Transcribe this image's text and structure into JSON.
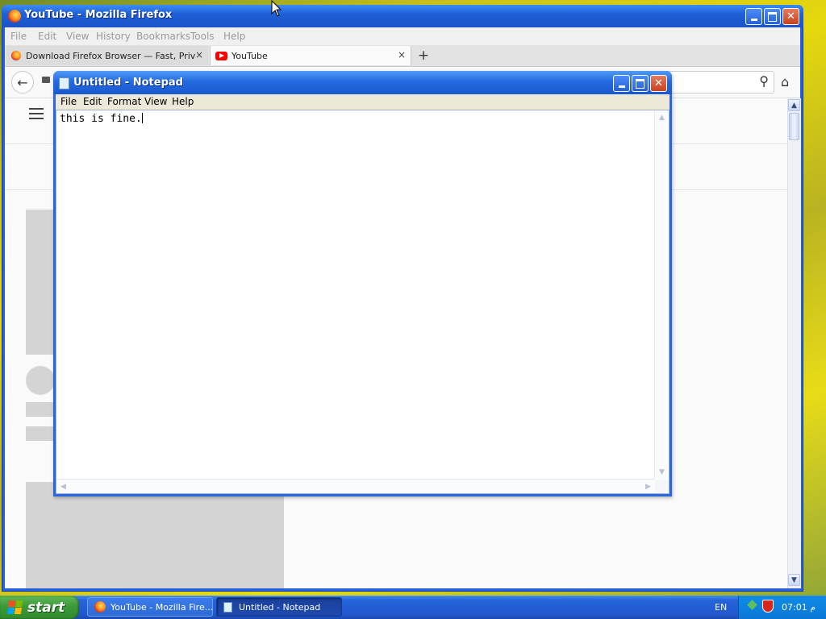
{
  "firefox": {
    "title": "YouTube - Mozilla Firefox",
    "menu": {
      "file": "File",
      "edit": "Edit",
      "view": "View",
      "history": "History",
      "bookmarks": "Bookmarks",
      "tools": "Tools",
      "help": "Help"
    },
    "tabs": [
      {
        "label": "Download Firefox Browser — Fast, Privat...",
        "active": false
      },
      {
        "label": "YouTube",
        "active": true
      }
    ],
    "new_tab": "+",
    "tab_close": "×"
  },
  "notepad": {
    "title": "Untitled - Notepad",
    "menu": {
      "file": "File",
      "edit": "Edit",
      "format": "Format",
      "view": "View",
      "help": "Help"
    },
    "text": "this is fine."
  },
  "taskbar": {
    "start_label": "start",
    "buttons": [
      {
        "label": "YouTube - Mozilla Fire...",
        "active": false
      },
      {
        "label": "Untitled - Notepad",
        "active": true
      }
    ],
    "language": "EN",
    "clock": "07:01 م"
  },
  "icons": {
    "back": "back-arrow-icon",
    "lock": "lock-icon",
    "search": "search-icon",
    "home": "home-icon",
    "hamburger": "hamburger-menu-icon"
  },
  "colors": {
    "xp_title_blue": "#1f5fd6",
    "close_red": "#c8421f",
    "start_green": "#3c9a38",
    "youtube_red": "#ff0000"
  }
}
